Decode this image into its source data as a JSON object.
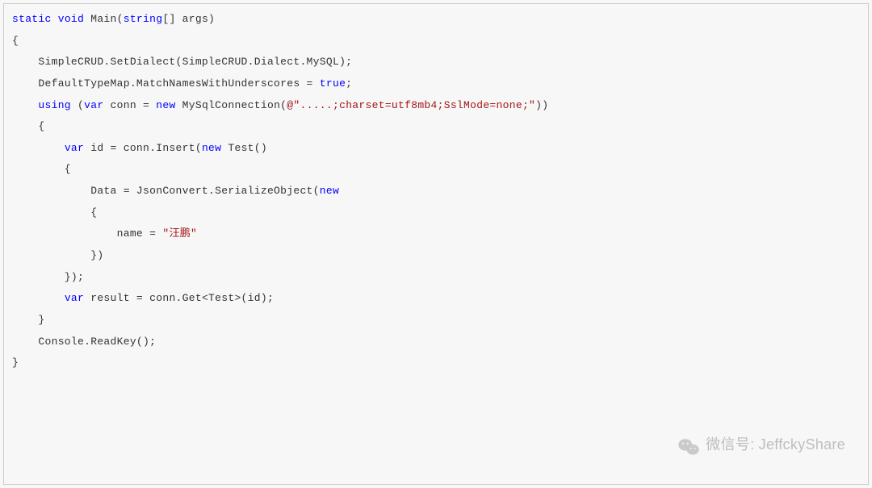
{
  "code": {
    "l1": {
      "p1": "static",
      "p2": " ",
      "p3": "void",
      "p4": " Main(",
      "p5": "string",
      "p6": "[] args)"
    },
    "l2": "{",
    "l3": "    SimpleCRUD.SetDialect(SimpleCRUD.Dialect.MySQL);",
    "l4": {
      "p1": "    DefaultTypeMap.MatchNamesWithUnderscores = ",
      "p2": "true",
      "p3": ";"
    },
    "l5": "",
    "l6": {
      "p1": "    ",
      "p2": "using",
      "p3": " (",
      "p4": "var",
      "p5": " conn = ",
      "p6": "new",
      "p7": " MySqlConnection(",
      "p8": "@\".....;charset=utf8mb4;SslMode=none;\"",
      "p9": "))"
    },
    "l7": "",
    "l8": "    {",
    "l9": {
      "p1": "        ",
      "p2": "var",
      "p3": " id = conn.Insert(",
      "p4": "new",
      "p5": " Test()"
    },
    "l10": "        {",
    "l11": {
      "p1": "            Data = JsonConvert.SerializeObject(",
      "p2": "new"
    },
    "l12": "            {",
    "l13": {
      "p1": "                name = ",
      "p2": "\"汪鹏\""
    },
    "l14": "            })",
    "l15": "        });",
    "l16": "",
    "l17": {
      "p1": "        ",
      "p2": "var",
      "p3": " result = conn.Get<Test>(id);"
    },
    "l18": "    }",
    "l19": "",
    "l20": "    Console.ReadKey();",
    "l21": "}"
  },
  "watermark": {
    "label": "微信号: JeffckyShare"
  }
}
